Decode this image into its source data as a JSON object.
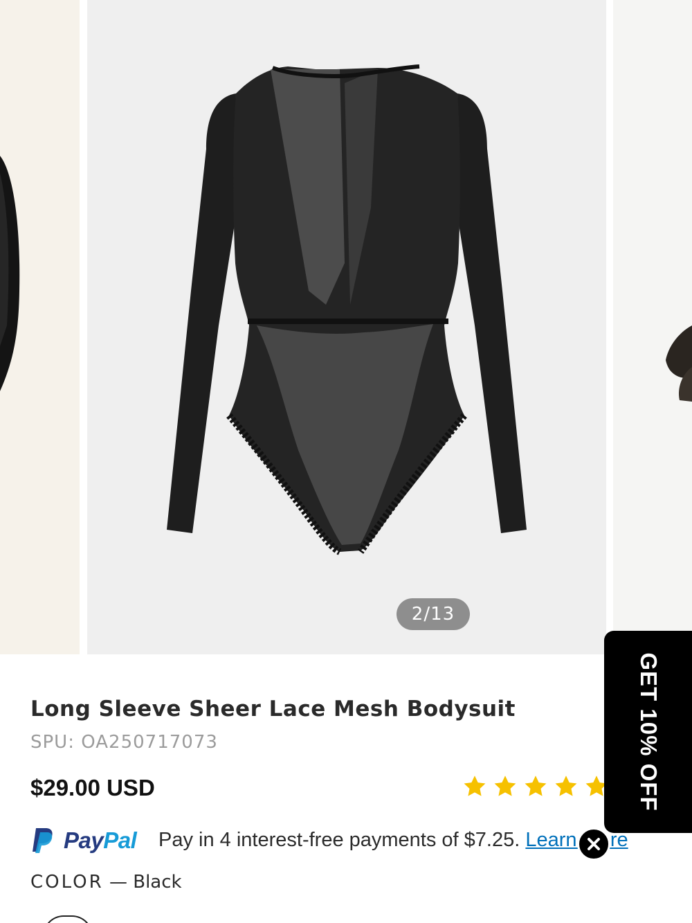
{
  "gallery": {
    "counter": "2/13",
    "main_image": "black-lace-mesh-bodysuit",
    "prev_image": "model-in-black-bodysuit",
    "next_image": "model-in-knit-coat"
  },
  "product": {
    "title": "Long Sleeve Sheer Lace Mesh Bodysuit",
    "spu": "SPU: OA250717073",
    "price": "$29.00 USD",
    "rating": 5,
    "rating_max": 5
  },
  "paypal": {
    "pay": "Pay",
    "pal": "Pal",
    "message": "Pay in 4 interest-free payments of $7.25.",
    "link_text": "Learn more"
  },
  "color": {
    "label": "COLOR",
    "separator": "—",
    "value": "Black"
  },
  "promo": {
    "text": "GET 10% OFF",
    "close_icon": "close-icon"
  },
  "colors": {
    "star": "#f6c100",
    "paypal_dark": "#253b80",
    "paypal_light": "#179bd7",
    "link": "#0070ba",
    "promo_bg": "#000000"
  }
}
